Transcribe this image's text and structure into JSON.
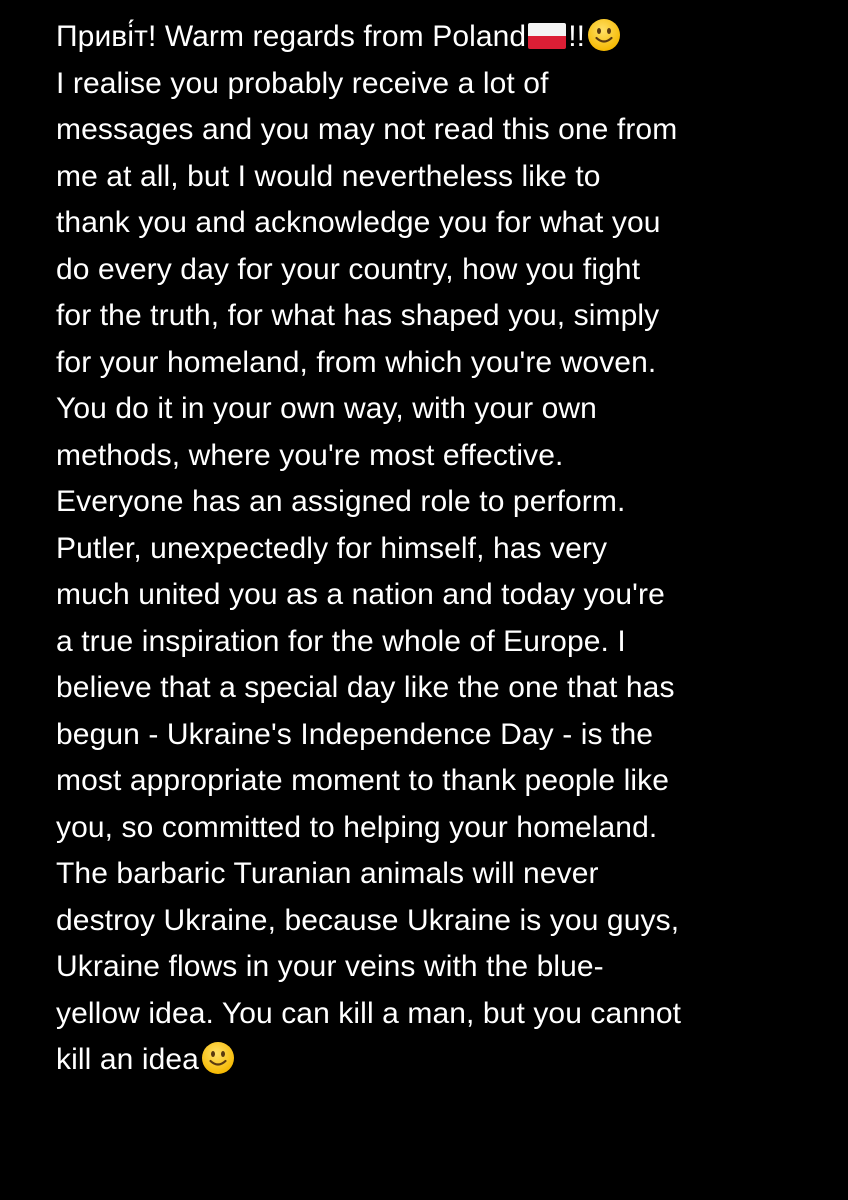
{
  "note": {
    "lines": [
      {
        "pre": "Приві́т! Warm regards from Poland",
        "post": "!!"
      },
      "I realise you probably receive a lot of",
      "messages and you may not read this one from",
      "me at all, but I would nevertheless like to",
      "thank you and acknowledge you for what you",
      "do every day for your country, how you fight",
      "for the truth, for what has shaped you, simply",
      "for your homeland, from which you're woven.",
      "You do it in your own way, with your own",
      "methods, where you're most effective.",
      "Everyone has an assigned role to perform.",
      "Putler, unexpectedly for himself, has very",
      "much united you as a nation and today you're",
      "a true inspiration for the whole of Europe. I",
      "believe that a special day like the one that has",
      "begun - Ukraine's Independence Day - is the",
      "most appropriate moment to thank people like",
      "you, so committed to helping your homeland.",
      "The barbaric Turanian animals will never",
      "destroy Ukraine, because Ukraine is you guys,",
      "Ukraine flows in your veins with the blue-",
      "yellow idea. You can kill a man, but you cannot",
      {
        "pre": "kill an idea",
        "post": ""
      }
    ]
  },
  "icons": {
    "flag": "poland-flag-emoji",
    "smiley": "slightly-smiling-face-emoji"
  },
  "colors": {
    "background": "#000000",
    "text": "#ffffff",
    "emoji_face": "#ffcc33",
    "flag_red": "#dc1e35",
    "flag_white": "#f4f4f4"
  }
}
